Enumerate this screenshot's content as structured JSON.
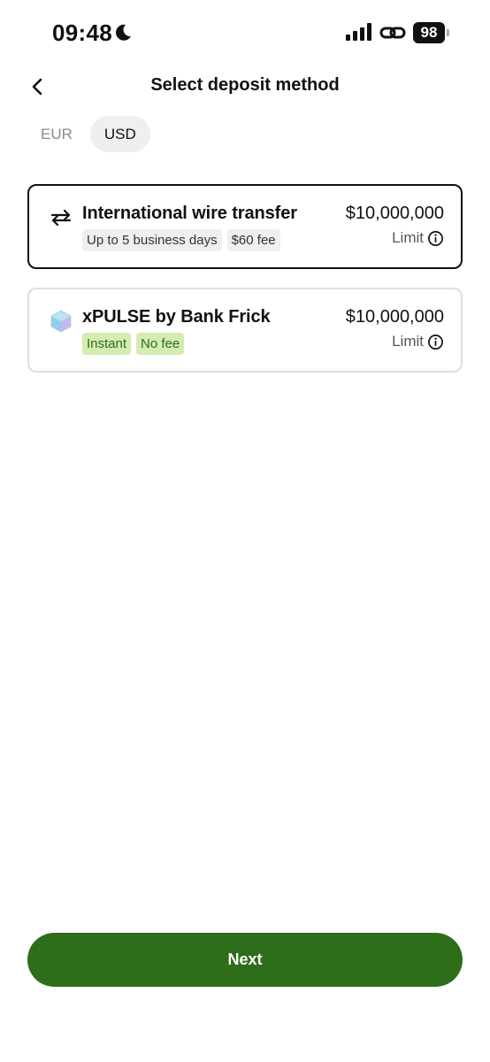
{
  "status_bar": {
    "time": "09:48",
    "battery": "98",
    "icons": [
      "moon-icon",
      "signal-icon",
      "link-icon",
      "battery-icon"
    ]
  },
  "header": {
    "title": "Select deposit method",
    "back_icon": "chevron-left-icon"
  },
  "currency_tabs": [
    {
      "label": "EUR",
      "selected": false
    },
    {
      "label": "USD",
      "selected": true
    }
  ],
  "methods": [
    {
      "title": "International wire transfer",
      "icon": "transfer-arrows-icon",
      "badges": [
        "Up to 5 business days",
        "$60 fee"
      ],
      "amount": "$10,000,000",
      "limit_label": "Limit",
      "selected": true
    },
    {
      "title": "xPULSE by Bank Frick",
      "icon": "xpulse-cube-icon",
      "badges": [
        "Instant",
        "No fee"
      ],
      "amount": "$10,000,000",
      "limit_label": "Limit",
      "selected": false
    }
  ],
  "footer": {
    "next_label": "Next"
  },
  "colors": {
    "accent": "#2e6e1a",
    "badge_green_bg": "#d4ecb1",
    "badge_green_text": "#2e6e14",
    "badge_gray_bg": "#efefef"
  }
}
